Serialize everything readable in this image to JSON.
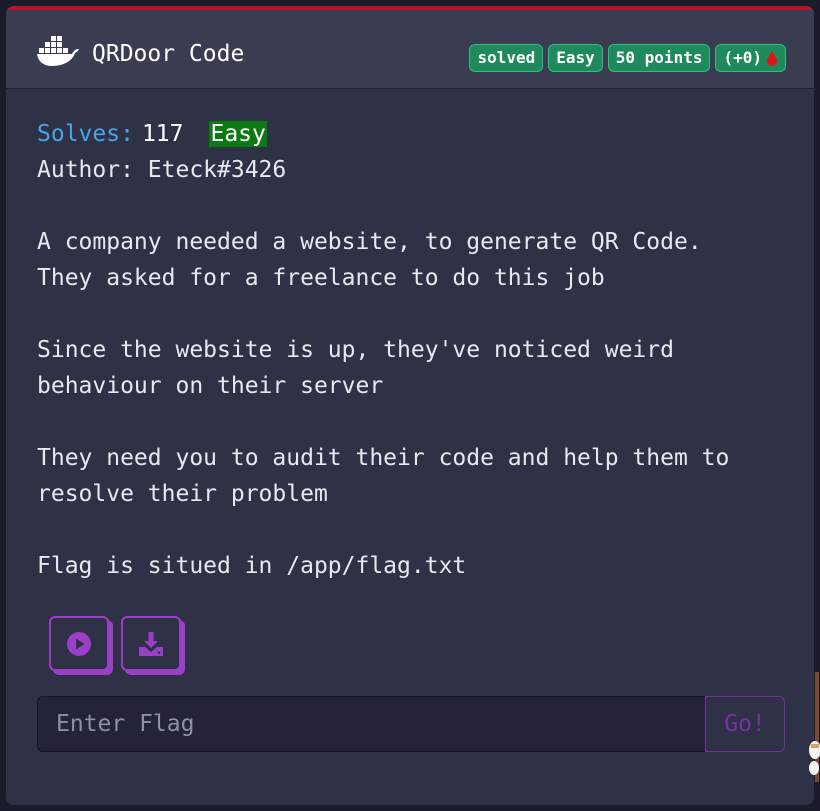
{
  "challenge": {
    "title": "QRDoor Code",
    "badges": {
      "solved": "solved",
      "difficulty": "Easy",
      "points": "50 points",
      "bonus": "(+0)"
    },
    "solves_label": "Solves:",
    "solves_count": "117",
    "difficulty_tag": "Easy",
    "author_line": "Author: Eteck#3426",
    "description": {
      "p1_l1": "A company needed a website, to generate QR Code.",
      "p1_l2": "They asked for a freelance to do this job",
      "p2_l1": "Since the website is up, they've noticed weird",
      "p2_l2": "behaviour on their server",
      "p3_l1": "They need you to audit their code and help them to",
      "p3_l2": "resolve their problem",
      "p4_l1": "Flag is situed in /app/flag.txt"
    }
  },
  "flag_form": {
    "placeholder": "Enter Flag",
    "value": "",
    "submit_label": "Go!"
  },
  "icons": {
    "logo": "docker-whale-icon",
    "blood": "blood-drop-icon",
    "start": "play-circle-icon",
    "download": "download-icon"
  },
  "colors": {
    "accent_purple": "#9b3fc6",
    "badge_green": "#1f8a5c",
    "solves_blue": "#4aa3e6",
    "easy_green": "#0b7a12",
    "top_red": "#b8152b"
  }
}
